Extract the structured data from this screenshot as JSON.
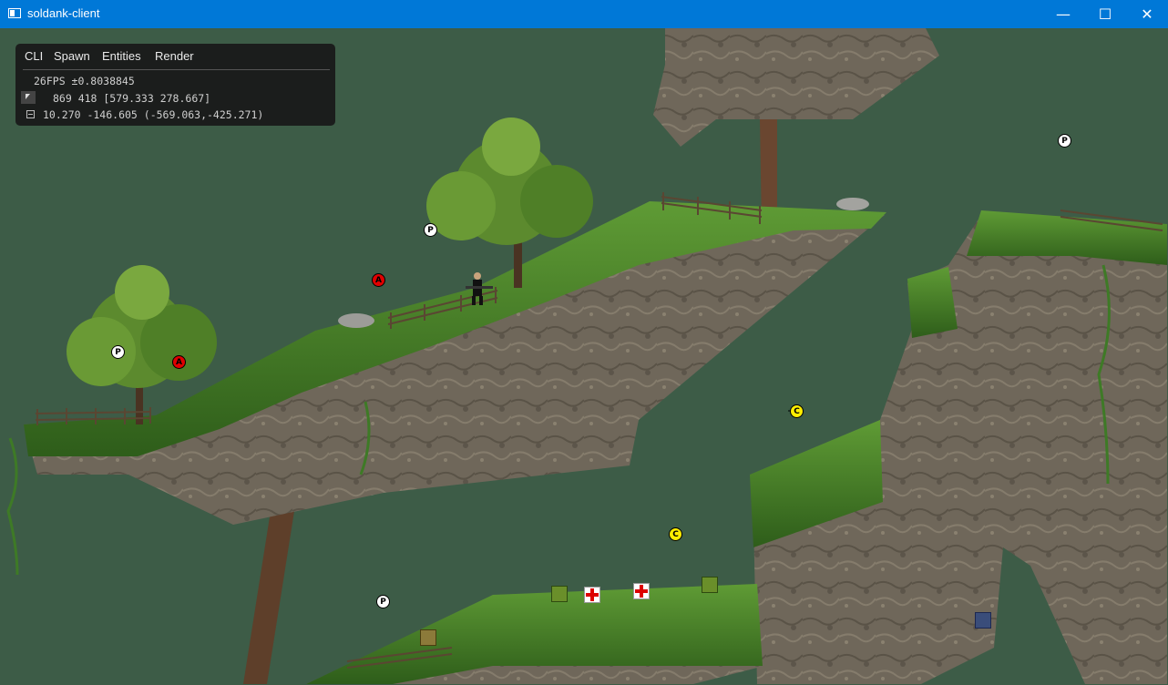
{
  "window": {
    "title": "soldank-client",
    "minimize_glyph": "—",
    "maximize_glyph": "☐",
    "close_glyph": "✕"
  },
  "hud": {
    "menu": [
      "CLI",
      "Spawn",
      "Entities",
      "Render"
    ],
    "fps_line": "26FPS ±0.8038845",
    "mouse_line": "869 418 [579.333 278.667]",
    "world_line": "10.270 -146.605 (-569.063,-425.271)",
    "mouse_icon": "cursor-icon",
    "world_icon": "world-icon"
  },
  "markers": [
    {
      "id": "p1",
      "letter": "P",
      "kind": "player-spawn"
    },
    {
      "id": "p2",
      "letter": "P",
      "kind": "player-spawn"
    },
    {
      "id": "p3",
      "letter": "P",
      "kind": "player-spawn"
    },
    {
      "id": "p4",
      "letter": "P",
      "kind": "player-spawn"
    },
    {
      "id": "a1",
      "letter": "A",
      "kind": "alpha-spawn"
    },
    {
      "id": "a2",
      "letter": "A",
      "kind": "alpha-spawn"
    },
    {
      "id": "c1",
      "letter": "C",
      "kind": "crosshair-target"
    },
    {
      "id": "c2",
      "letter": "C",
      "kind": "crosshair-target"
    }
  ],
  "colors": {
    "titlebar": "#0078d7",
    "sky": "#3d5c47",
    "grass": "#3f7a22",
    "rock": "#6d6557",
    "marker_red": "#e00000",
    "marker_yellow": "#ffee00"
  }
}
